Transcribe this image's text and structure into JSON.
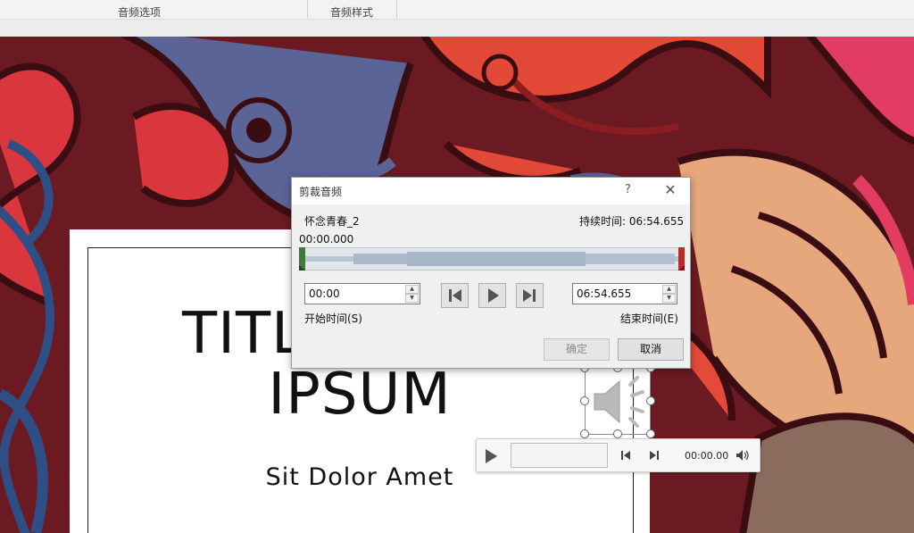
{
  "ribbon": {
    "group_audio_options": "音频选项",
    "group_audio_styles": "音频样式"
  },
  "slide": {
    "title_line1": "TITL",
    "title_line2": "IPSUM",
    "subtitle": "Sit Dolor Amet"
  },
  "player": {
    "time": "00:00.00"
  },
  "dialog": {
    "title": "剪裁音频",
    "help": "?",
    "close": "✕",
    "file_name": "怀念青春_2",
    "duration_label": "持续时间: 06:54.655",
    "position": "00:00.000",
    "start_time_value": "00:00",
    "end_time_value": "06:54.655",
    "start_time_label": "开始时间(S)",
    "end_time_label": "结束时间(E)",
    "ok_label": "确定",
    "cancel_label": "取消"
  },
  "colors": {
    "background": "#6b1a22",
    "dialog_bg": "#f0f0f0",
    "marker_green": "#3a7a3a",
    "marker_red": "#c0282d"
  },
  "icons": [
    "help-icon",
    "close-icon",
    "previous-frame-icon",
    "play-icon",
    "next-frame-icon",
    "speaker-icon",
    "volume-icon"
  ]
}
